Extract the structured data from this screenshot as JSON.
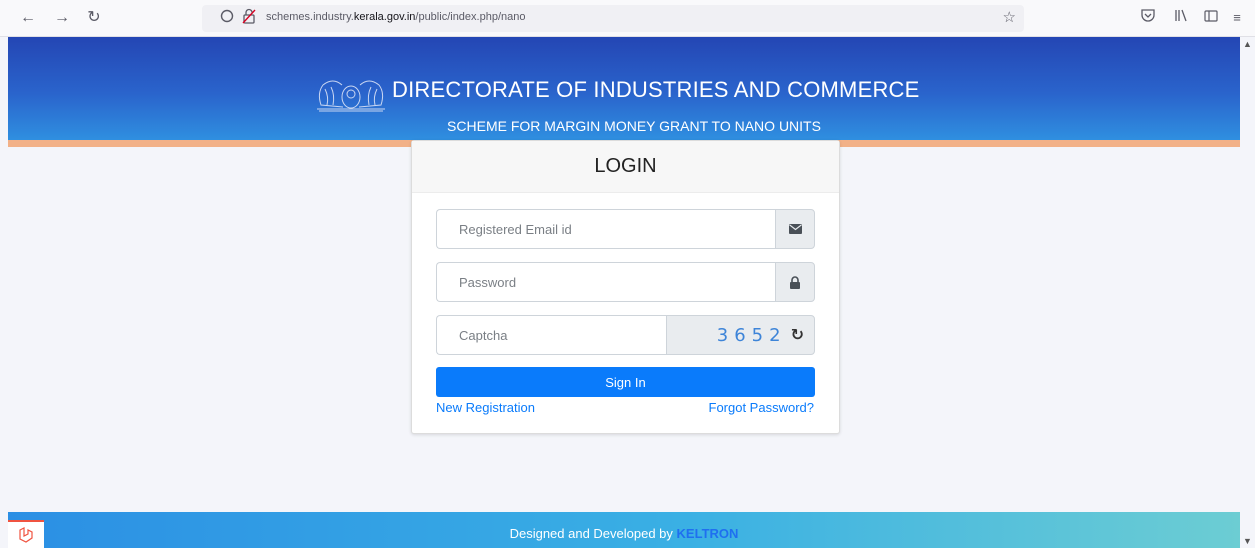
{
  "browser": {
    "url_prefix": "schemes.industry.",
    "url_domain": "kerala.gov.in",
    "url_path": "/public/index.php/nano"
  },
  "header": {
    "title": "DIRECTORATE OF INDUSTRIES AND COMMERCE",
    "subtitle": "SCHEME FOR MARGIN MONEY GRANT TO NANO UNITS"
  },
  "login": {
    "title": "LOGIN",
    "email_placeholder": "Registered Email id",
    "password_placeholder": "Password",
    "captcha_placeholder": "Captcha",
    "captcha_value": "3652",
    "signin_label": "Sign In",
    "new_registration_label": "New Registration",
    "forgot_password_label": "Forgot Password?"
  },
  "footer": {
    "text": "Designed and Developed by",
    "brand": "KELTRON"
  },
  "colors": {
    "primary": "#0a7bfb",
    "header_blue": "#2446b4",
    "stripe": "#f2b188"
  }
}
